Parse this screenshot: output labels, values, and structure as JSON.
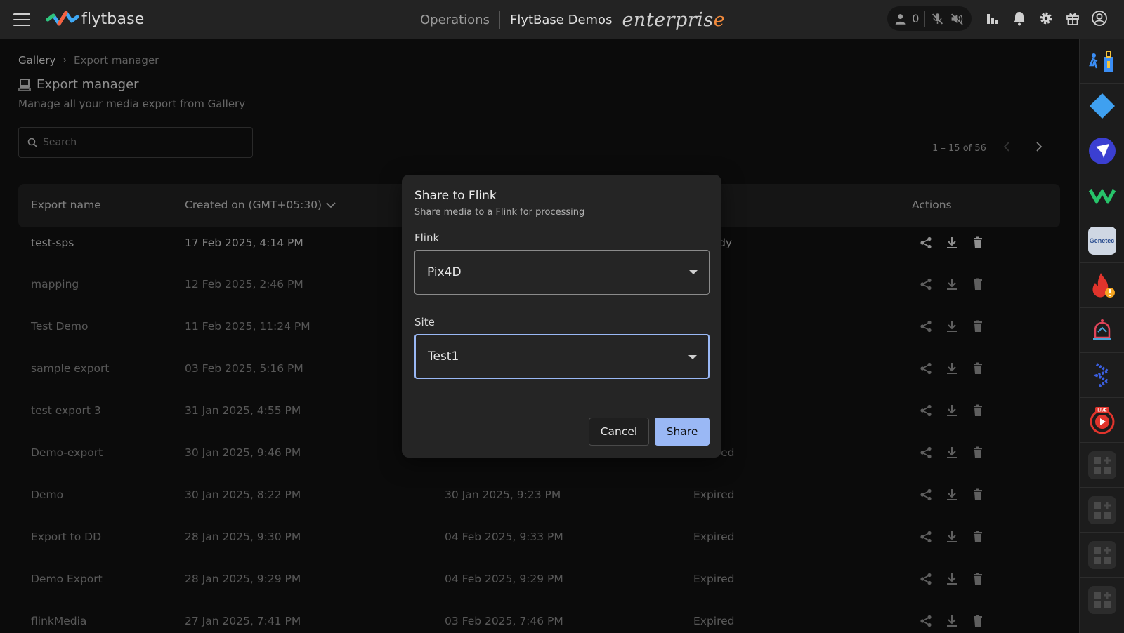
{
  "header": {
    "logo_text": "flytbase",
    "nav_operations": "Operations",
    "org_name": "FlytBase Demos",
    "edition_main": "enterpris",
    "edition_accent": "e",
    "active_users": "0"
  },
  "breadcrumb": {
    "home": "Gallery",
    "separator": "›",
    "current": "Export manager"
  },
  "page": {
    "title": "Export manager",
    "subtitle": "Manage all your media export from Gallery"
  },
  "search": {
    "placeholder": "Search",
    "value": ""
  },
  "pagination": {
    "range": "1 – 15 of 56"
  },
  "table": {
    "headers": {
      "name": "Export name",
      "created": "Created on (GMT+05:30)",
      "expires": "",
      "status": "s",
      "actions": "Actions"
    },
    "rows": [
      {
        "name": "test-sps",
        "created": "17 Feb 2025, 4:14 PM",
        "expires": "",
        "status": "t ready"
      },
      {
        "name": "mapping",
        "created": "12 Feb 2025, 2:46 PM",
        "expires": "",
        "status": "ed"
      },
      {
        "name": "Test Demo",
        "created": "11 Feb 2025, 11:24 PM",
        "expires": "",
        "status": "ed"
      },
      {
        "name": "sample export",
        "created": "03 Feb 2025, 5:16 PM",
        "expires": "",
        "status": "ed"
      },
      {
        "name": "test export 3",
        "created": "31 Jan 2025, 4:55 PM",
        "expires": "",
        "status": "ed"
      },
      {
        "name": "Demo-export",
        "created": "30 Jan 2025, 9:46 PM",
        "expires": "06 Feb 2025, 9:46 PM",
        "status": "Expired"
      },
      {
        "name": "Demo",
        "created": "30 Jan 2025, 8:22 PM",
        "expires": "30 Jan 2025, 9:23 PM",
        "status": "Expired"
      },
      {
        "name": "Export to DD",
        "created": "28 Jan 2025, 9:30 PM",
        "expires": "04 Feb 2025, 9:33 PM",
        "status": "Expired"
      },
      {
        "name": "Demo Export",
        "created": "28 Jan 2025, 9:29 PM",
        "expires": "04 Feb 2025, 9:29 PM",
        "status": "Expired"
      },
      {
        "name": "flinkMedia",
        "created": "27 Jan 2025, 7:41 PM",
        "expires": "03 Feb 2025, 7:46 PM",
        "status": "Expired"
      }
    ]
  },
  "rail": {
    "genetec_label": "Genetec",
    "live_label": "LIVE"
  },
  "modal": {
    "title": "Share to Flink",
    "subtitle": "Share media to a Flink for processing",
    "flink_label": "Flink",
    "flink_value": "Pix4D",
    "site_label": "Site",
    "site_value": "Test1",
    "cancel_label": "Cancel",
    "share_label": "Share"
  },
  "colors": {
    "accent": "#9ab8f5",
    "background": "#121212",
    "topbar": "#232323",
    "modal": "#252525"
  }
}
